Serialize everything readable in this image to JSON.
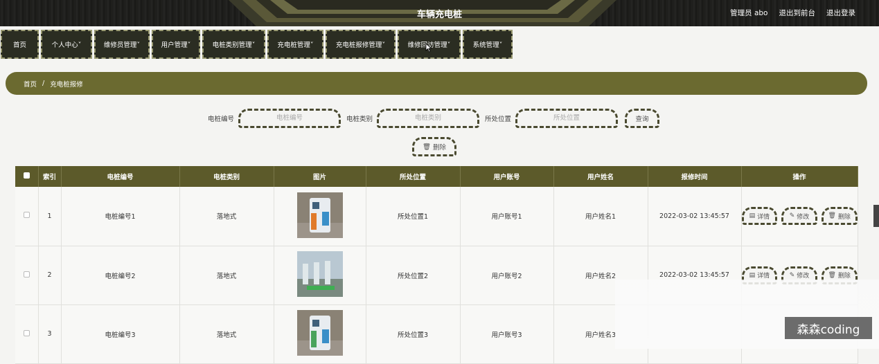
{
  "header": {
    "title": "车辆充电桩",
    "admin": "管理员 abo",
    "front_link": "退出到前台",
    "logout_link": "退出登录"
  },
  "nav": {
    "items": [
      {
        "label": "首页"
      },
      {
        "label": "个人中心˅"
      },
      {
        "label": "维修员管理˅"
      },
      {
        "label": "用户管理˅"
      },
      {
        "label": "电桩类别管理˅"
      },
      {
        "label": "充电桩管理˅"
      },
      {
        "label": "充电桩报修管理˅"
      },
      {
        "label": "维修回访管理˅"
      },
      {
        "label": "系统管理˅"
      }
    ]
  },
  "breadcrumb": {
    "home": "首页",
    "sep": "/",
    "current": "充电桩报修"
  },
  "search": {
    "f1_label": "电桩编号",
    "f1_placeholder": "电桩编号",
    "f2_label": "电桩类别",
    "f2_placeholder": "电桩类别",
    "f3_label": "所处位置",
    "f3_placeholder": "所处位置",
    "query": "查询",
    "delete": "删除"
  },
  "table": {
    "headers": {
      "index": "索引",
      "code": "电桩编号",
      "type": "电桩类别",
      "image": "图片",
      "location": "所处位置",
      "account": "用户账号",
      "name": "用户姓名",
      "time": "报修时间",
      "ops": "操作"
    },
    "rows": [
      {
        "index": "1",
        "code": "电桩编号1",
        "type": "落地式",
        "location": "所处位置1",
        "account": "用户账号1",
        "name": "用户姓名1",
        "time": "2022-03-02 13:45:57"
      },
      {
        "index": "2",
        "code": "电桩编号2",
        "type": "落地式",
        "location": "所处位置2",
        "account": "用户账号2",
        "name": "用户姓名2",
        "time": "2022-03-02 13:45:57"
      },
      {
        "index": "3",
        "code": "电桩编号3",
        "type": "落地式",
        "location": "所处位置3",
        "account": "用户账号3",
        "name": "用户姓名3",
        "time": ""
      }
    ],
    "ops": {
      "detail": "详情",
      "edit": "修改",
      "delete": "删除"
    }
  },
  "watermark": "森森coding",
  "colors": {
    "accent": "#5c5a2a",
    "breadcrumb": "#6b6a30",
    "topbar": "#1c1c1a"
  }
}
